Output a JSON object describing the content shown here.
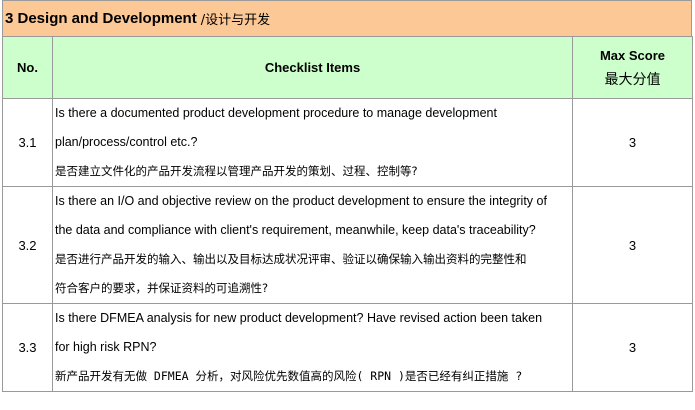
{
  "section": {
    "title_en": "3 Design and Development",
    "title_zh": "/设计与开发"
  },
  "header": {
    "no": "No.",
    "items": "Checklist Items",
    "max_en": "Max Score",
    "max_zh": "最大分值"
  },
  "rows": [
    {
      "no": "3.1",
      "lines": [
        "Is there a documented product development procedure to manage development",
        "plan/process/control etc.?",
        "是否建立文件化的产品开发流程以管理产品开发的策划、过程、控制等?"
      ],
      "score": "3"
    },
    {
      "no": "3.2",
      "lines": [
        "Is there an I/O and objective review on    the product development to ensure the integrity of",
        "the data and compliance with client's requirement, meanwhile, keep data's traceability?",
        "是否进行产品开发的输入、输出以及目标达成状况评审、验证以确保输入输出资料的完整性和",
        "符合客户的要求，并保证资料的可追溯性?"
      ],
      "score": "3"
    },
    {
      "no": "3.3",
      "lines": [
        "Is there DFMEA analysis for new product development? Have revised action    been taken",
        "for high risk RPN?",
        "新产品开发有无做 DFMEA 分析，对风险优先数值高的风险( RPN )是否已经有纠正措施 ?"
      ],
      "score": "3"
    }
  ]
}
